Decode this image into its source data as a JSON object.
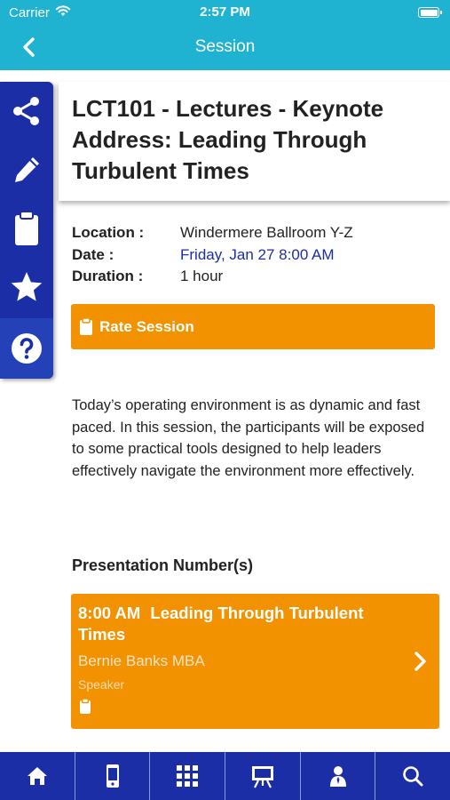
{
  "status_bar": {
    "carrier": "Carrier",
    "time": "2:57 PM"
  },
  "nav": {
    "title": "Session",
    "back_icon": "chevron-left-icon"
  },
  "sidebar": {
    "items": [
      {
        "name": "share",
        "icon": "share-icon"
      },
      {
        "name": "notes",
        "icon": "pencil-icon"
      },
      {
        "name": "evaluation",
        "icon": "clipboard-icon"
      },
      {
        "name": "favorite",
        "icon": "star-icon"
      },
      {
        "name": "help",
        "icon": "question-icon"
      }
    ]
  },
  "session": {
    "title": "LCT101 - Lectures - Keynote Address: Leading Through Turbulent Times",
    "location_label": "Location :",
    "location": "Windermere Ballroom Y-Z",
    "date_label": "Date :",
    "date": "Friday, Jan 27 8:00 AM",
    "duration_label": "Duration :",
    "duration": "1 hour",
    "rate_label": "Rate Session",
    "description": "Today’s operating environment is as dynamic and fast paced. In this session, the participants will be exposed to some practical tools designed to help leaders effectively navigate the environment more effectively."
  },
  "presentations": {
    "heading": "Presentation Number(s)",
    "items": [
      {
        "time": "8:00 AM",
        "title": "Leading Through Turbulent Times",
        "speaker": "Bernie Banks MBA",
        "role": "Speaker"
      }
    ]
  },
  "tabbar": {
    "items": [
      {
        "name": "home",
        "icon": "home-icon"
      },
      {
        "name": "device",
        "icon": "mobile-device-icon"
      },
      {
        "name": "grid",
        "icon": "grid-icon"
      },
      {
        "name": "presentation",
        "icon": "easel-icon"
      },
      {
        "name": "speakers",
        "icon": "speaker-icon"
      },
      {
        "name": "search",
        "icon": "search-icon"
      }
    ]
  },
  "colors": {
    "header": "#1fb3d1",
    "sidebar": "#1b2ea6",
    "accent": "#f39200",
    "link": "#1b2ea6"
  }
}
